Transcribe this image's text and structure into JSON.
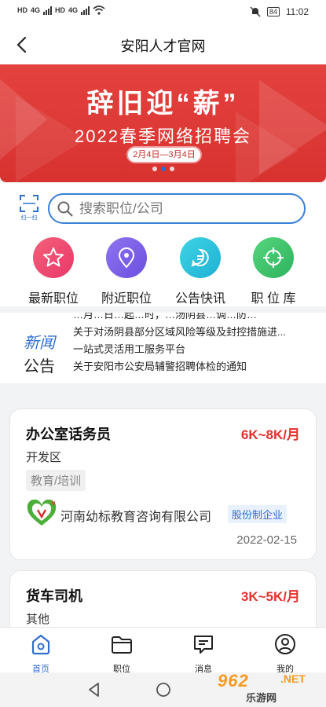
{
  "status_bar": {
    "sim1": "HD",
    "sim2": "HD",
    "net1": "4G",
    "net2": "4G",
    "battery": "84",
    "time": "11:02"
  },
  "header": {
    "title": "安阳人才官网"
  },
  "banner": {
    "headline": "辞旧迎“薪”",
    "subtitle": "2022春季网络招聘会",
    "dates": "2月4日—3月4日"
  },
  "search": {
    "scan_label": "扫一扫",
    "placeholder": "搜索职位/公司"
  },
  "quick_links": [
    {
      "label": "最新职位",
      "icon": "star-icon",
      "color": "#ef4b73"
    },
    {
      "label": "附近职位",
      "icon": "location-pin-icon",
      "color": "#7b5ee8"
    },
    {
      "label": "公告快讯",
      "icon": "chat-bubble-icon",
      "color": "#27c1d9"
    },
    {
      "label": "职 位 库",
      "icon": "target-icon",
      "color": "#37c46b"
    }
  ],
  "news": {
    "tag_top": "新闻",
    "tag_bottom": "公告",
    "items": [
      "…月…日…起…时，…汤阴县…调…防…",
      "关于对汤阴县部分区域风险等级及封控措施进...",
      "一站式灵活用工服务平台",
      "关于安阳市公安局辅警招聘体检的通知"
    ]
  },
  "jobs": [
    {
      "title": "办公室话务员",
      "salary": "6K~8K/月",
      "area": "开发区",
      "category": "教育/培训",
      "company": "河南幼标教育咨询有限公司",
      "company_type": "股份制企业",
      "date": "2022-02-15"
    },
    {
      "title": "货车司机",
      "salary": "3K~5K/月",
      "area": "其他"
    }
  ],
  "tabs": [
    {
      "label": "首页",
      "icon": "home-icon"
    },
    {
      "label": "职位",
      "icon": "folder-icon"
    },
    {
      "label": "消息",
      "icon": "message-icon"
    },
    {
      "label": "我的",
      "icon": "user-icon"
    }
  ],
  "watermark": {
    "num_a": "962",
    "num_b": ".NET",
    "cn": "乐游网"
  },
  "colors": {
    "accent": "#2f6fd0",
    "salary": "#e5302b",
    "banner": "#e4423f"
  }
}
